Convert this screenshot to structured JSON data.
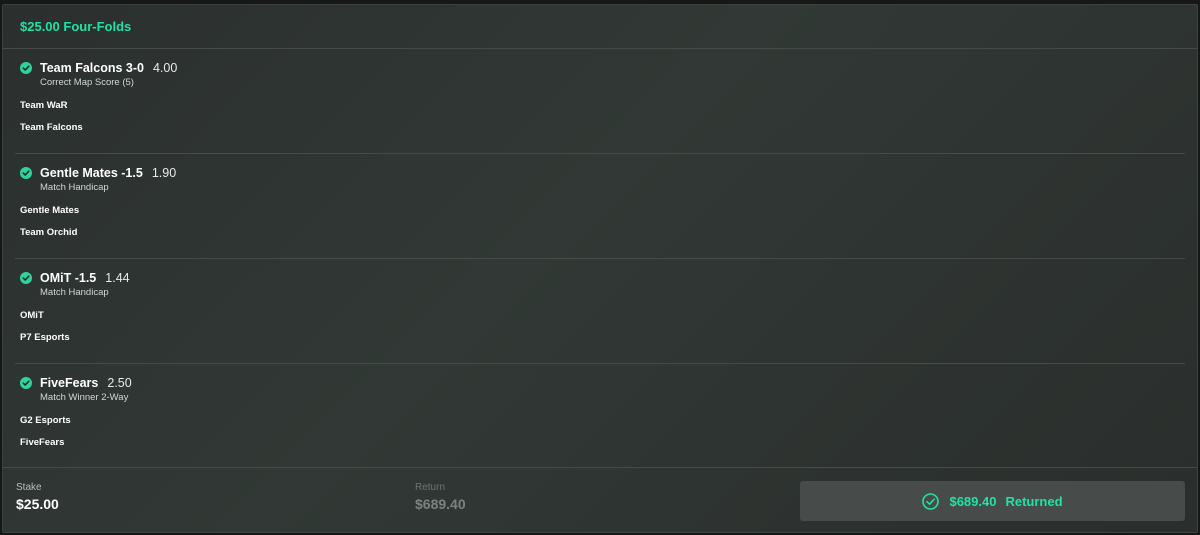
{
  "bet": {
    "title": "$25.00 Four-Folds",
    "selections": [
      {
        "name": "Team Falcons 3-0",
        "odds": "4.00",
        "market": "Correct Map Score (5)",
        "team1": "Team WaR",
        "team2": "Team Falcons",
        "status_icon": "check-circle-icon"
      },
      {
        "name": "Gentle Mates -1.5",
        "odds": "1.90",
        "market": "Match Handicap",
        "team1": "Gentle Mates",
        "team2": "Team Orchid",
        "status_icon": "check-circle-icon"
      },
      {
        "name": "OMiT -1.5",
        "odds": "1.44",
        "market": "Match Handicap",
        "team1": "OMiT",
        "team2": "P7 Esports",
        "status_icon": "check-circle-icon"
      },
      {
        "name": "FiveFears",
        "odds": "2.50",
        "market": "Match Winner 2-Way",
        "team1": "G2 Esports",
        "team2": "FiveFears",
        "status_icon": "check-circle-icon"
      }
    ]
  },
  "footer": {
    "stake_label": "Stake",
    "stake_value": "$25.00",
    "return_label": "Return",
    "return_value": "$689.40",
    "returned_amount": "$689.40",
    "returned_text": "Returned",
    "returned_icon": "check-circle-outline-icon"
  },
  "colors": {
    "accent": "#1fe3a6",
    "background": "#2e3431",
    "divider": "#454b48",
    "button": "#474b49"
  }
}
